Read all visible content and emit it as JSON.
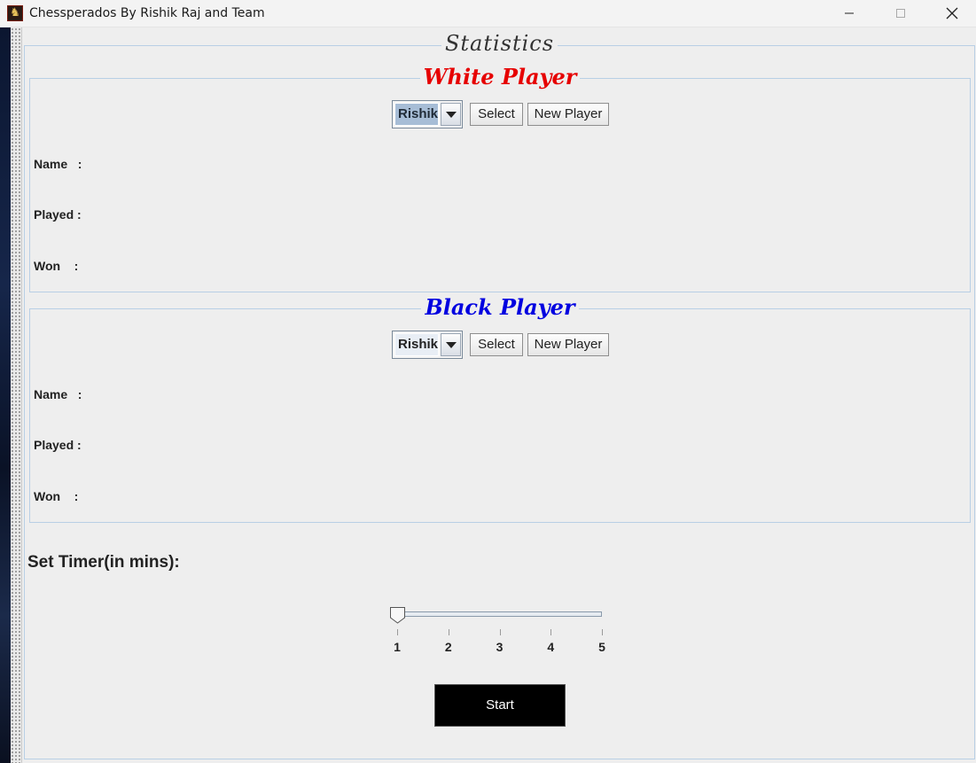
{
  "window": {
    "title": "Chessperados By Rishik Raj and Team",
    "icon": "chess-app-icon",
    "controls": [
      "minimize-icon",
      "maximize-icon",
      "close-icon"
    ]
  },
  "statistics": {
    "title": "Statistics",
    "white_player": {
      "title": "White Player",
      "title_color": "#e60000",
      "selected_player": "Rishik",
      "select_label": "Select",
      "new_player_label": "New Player",
      "name_label": "Name   :",
      "played_label": "Played :",
      "won_label": "Won    :"
    },
    "black_player": {
      "title": "Black Player",
      "title_color": "#0000e0",
      "selected_player": "Rishik",
      "select_label": "Select",
      "new_player_label": "New Player",
      "name_label": "Name   :",
      "played_label": "Played :",
      "won_label": "Won    :"
    }
  },
  "timer": {
    "label": "Set Timer(in mins):",
    "min": 1,
    "max": 5,
    "value": 1,
    "ticks": [
      "1",
      "2",
      "3",
      "4",
      "5"
    ]
  },
  "start_button": {
    "label": "Start",
    "background": "#000000"
  }
}
